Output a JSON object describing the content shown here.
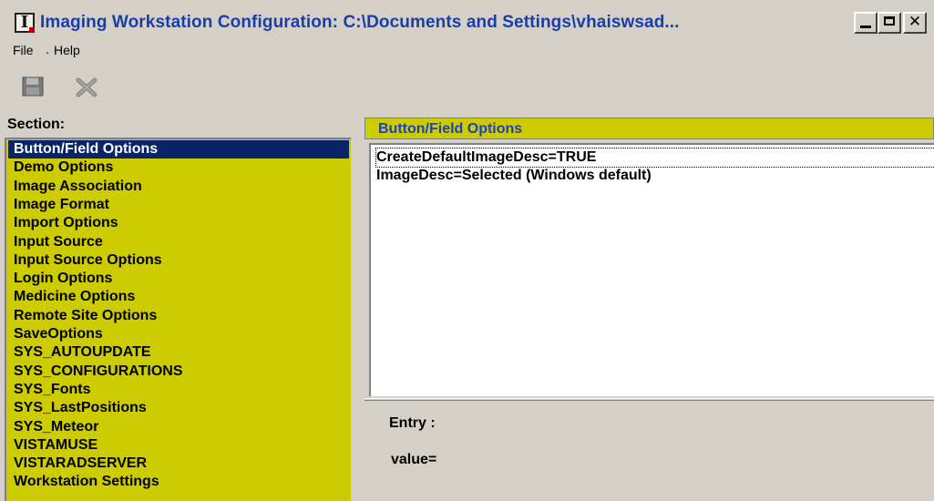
{
  "window": {
    "title": "Imaging Workstation Configuration:  C:\\Documents and Settings\\vhaiswsad...",
    "minimize_icon": "minimize-icon",
    "maximize_icon": "maximize-icon",
    "close_icon": "close-icon",
    "close_glyph": "✕"
  },
  "menu": {
    "file": "File",
    "separator": ".",
    "help": "Help"
  },
  "toolbar": {
    "save_icon": "floppy-disk-icon",
    "cancel_icon": "x-cancel-icon"
  },
  "left": {
    "label": "Section:",
    "selected_index": 0,
    "sections": [
      "Button/Field Options",
      "Demo Options",
      "Image Association",
      "Image Format",
      "Import Options",
      "Input Source",
      "Input Source Options",
      "Login Options",
      "Medicine Options",
      "Remote Site Options",
      "SaveOptions",
      "SYS_AUTOUPDATE",
      "SYS_CONFIGURATIONS",
      "SYS_Fonts",
      "SYS_LastPositions",
      "SYS_Meteor",
      "VISTAMUSE",
      "VISTARADSERVER",
      "Workstation Settings"
    ]
  },
  "right": {
    "header": "Button/Field Options",
    "options": [
      "CreateDefaultImageDesc=TRUE",
      "ImageDesc=Selected (Windows default)"
    ],
    "entry_label": "Entry :",
    "value_label": "value="
  },
  "colors": {
    "list_background": "#cccc00",
    "selection": "#0a246a",
    "title_text": "#1a3ea8",
    "header_text": "#1f3fc4"
  }
}
